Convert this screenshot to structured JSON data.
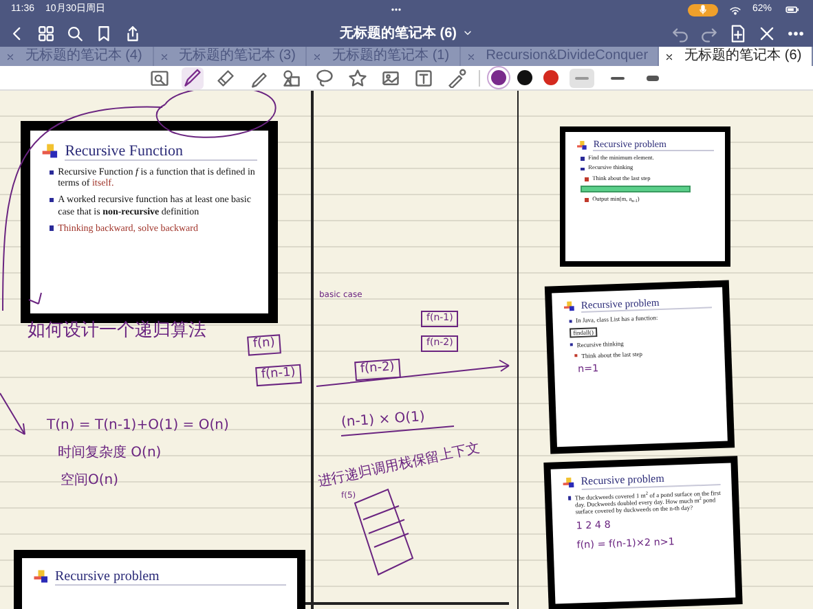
{
  "status_bar": {
    "time": "11:36",
    "date": "10月30日周日",
    "mic_on": true,
    "battery": "62%"
  },
  "nav": {
    "title": "无标题的笔记本 (6)"
  },
  "tabs": [
    {
      "label": "无标题的笔记本 (4)",
      "selected": false
    },
    {
      "label": "无标题的笔记本 (3)",
      "selected": false
    },
    {
      "label": "无标题的笔记本 (1)",
      "selected": false
    },
    {
      "label": "Recursion&DivideConquer",
      "selected": false
    },
    {
      "label": "无标题的笔记本 (6)",
      "selected": true
    }
  ],
  "toolbar": {
    "tools": [
      {
        "kind": "zoom",
        "selected": false
      },
      {
        "kind": "pen",
        "selected": true
      },
      {
        "kind": "eraser",
        "selected": false
      },
      {
        "kind": "highlighter",
        "selected": false
      },
      {
        "kind": "shapes",
        "selected": false
      },
      {
        "kind": "lasso",
        "selected": false
      },
      {
        "kind": "sticker",
        "selected": false
      },
      {
        "kind": "image",
        "selected": false
      },
      {
        "kind": "text",
        "selected": false
      },
      {
        "kind": "laser",
        "selected": false
      }
    ],
    "colors": [
      {
        "color": "#7a2a8c",
        "selected": true
      },
      {
        "color": "#111111",
        "selected": false
      },
      {
        "color": "#d42a1f",
        "selected": false
      }
    ],
    "widths": [
      {
        "kind": "thin",
        "selected": true
      },
      {
        "kind": "medium",
        "selected": false
      },
      {
        "kind": "thick",
        "selected": false
      }
    ]
  },
  "canvas": {
    "slides": [
      {
        "title": "Recursive Function",
        "bullets": [
          {
            "kind": "main",
            "parts": [
              {
                "text": "Recursive Function *f* is a function that is defined in terms of ",
                "accent": false
              },
              {
                "text": "itself.",
                "accent": true
              }
            ]
          },
          {
            "kind": "main",
            "parts": [
              {
                "text": "A worked recursive function has at least one basic case that is **non-recursive** definition",
                "accent": false
              }
            ]
          },
          {
            "kind": "main",
            "parts": [
              {
                "text": "Thinking backward, solve backward",
                "accent": true
              }
            ]
          }
        ]
      },
      {
        "title": "Recursive problem",
        "bullets": [
          {
            "kind": "main",
            "parts": [
              {
                "text": "Find the minimum element.",
                "accent": false
              }
            ]
          },
          {
            "kind": "main",
            "parts": [
              {
                "text": "Recursive thinking",
                "accent": false
              }
            ]
          },
          {
            "kind": "sub",
            "parts": [
              {
                "text": "Think about the last step",
                "accent": false
              }
            ]
          },
          {
            "kind": "bar"
          },
          {
            "kind": "sub",
            "parts": [
              {
                "text": "Output min(m, a$_{n-1}$)",
                "accent": false
              }
            ]
          }
        ]
      },
      {
        "title": "Recursive problem",
        "bullets": [
          {
            "kind": "main",
            "parts": [
              {
                "text": "In Java, class List has a function:",
                "accent": false
              }
            ]
          },
          {
            "kind": "code",
            "parts": [
              {
                "text": "findall()",
                "accent": false
              }
            ]
          },
          {
            "kind": "main",
            "parts": [
              {
                "text": "Recursive thinking",
                "accent": false
              }
            ]
          },
          {
            "kind": "sub",
            "parts": [
              {
                "text": "Think about the last step",
                "accent": false
              }
            ]
          }
        ],
        "annotations": [
          {
            "text": "n=1"
          }
        ]
      },
      {
        "title": "Recursive problem",
        "bullets": [
          {
            "kind": "main",
            "parts": [
              {
                "text": "The duckweeds covered 1 m$^{2}$ of a pond surface on the first day. Duckweeds doubled every day. How much m$^{2}$ pond surface covered by duckweeds on the n-th day?",
                "accent": false
              }
            ]
          }
        ],
        "annotations": [
          {
            "text": "1  2  4  8"
          },
          {
            "text": "f(n) = f(n-1)×2   n>1"
          }
        ]
      },
      {
        "title": "Recursive problem"
      }
    ],
    "notes": [
      {
        "text": "如何设计一个递归算法",
        "boxed": false
      },
      {
        "text": "basic case",
        "boxed": false
      },
      {
        "text": "f(n)",
        "boxed": true
      },
      {
        "text": "f(n-1)",
        "boxed": true
      },
      {
        "text": "f(n-2)",
        "boxed": true
      },
      {
        "text": "f(n-1)",
        "boxed": true
      },
      {
        "text": "f(n-2)",
        "boxed": true
      },
      {
        "text": "T(n) = T(n-1)+O(1) = O(n)",
        "boxed": false
      },
      {
        "text": "时间复杂度 O(n)",
        "boxed": false
      },
      {
        "text": "空间O(n)",
        "boxed": false
      },
      {
        "text": "(n-1) × O(1)",
        "boxed": false
      },
      {
        "text": "进行递归调用栈保留上下文",
        "boxed": false
      },
      {
        "text": "f(5)",
        "boxed": false
      }
    ]
  }
}
